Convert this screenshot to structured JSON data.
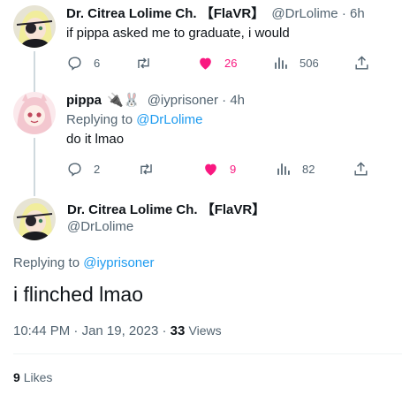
{
  "colors": {
    "accent": "#1d9bf0",
    "like": "#f91880",
    "muted": "#536471",
    "text": "#0f1419"
  },
  "tweet1": {
    "display_name": "Dr. Citrea Lolime Ch. 【FlaVR】",
    "handle": "@DrLolime",
    "separator": "·",
    "time": "6h",
    "text": "if pippa asked me to graduate, i would",
    "replies": "6",
    "likes": "26",
    "views": "506",
    "liked": true
  },
  "tweet2": {
    "display_name": "pippa",
    "name_emoji": "🔌🐰",
    "handle": "@iyprisoner",
    "separator": "·",
    "time": "4h",
    "replying_to_prefix": "Replying to",
    "replying_to_handle": "@DrLolime",
    "text": "do it lmao",
    "replies": "2",
    "likes": "9",
    "views": "82",
    "liked": true
  },
  "focused": {
    "display_name": "Dr. Citrea Lolime Ch. 【FlaVR】",
    "handle": "@DrLolime",
    "replying_to_prefix": "Replying to",
    "replying_to_handle": "@iyprisoner",
    "text": "i flinched lmao",
    "time": "10:44 PM",
    "date": "Jan 19, 2023",
    "separator": "·",
    "views_count": "33",
    "views_label": "Views",
    "likes_count": "9",
    "likes_label": "Likes"
  },
  "icons": [
    "reply-icon",
    "retweet-icon",
    "like-icon",
    "views-icon",
    "share-icon"
  ]
}
